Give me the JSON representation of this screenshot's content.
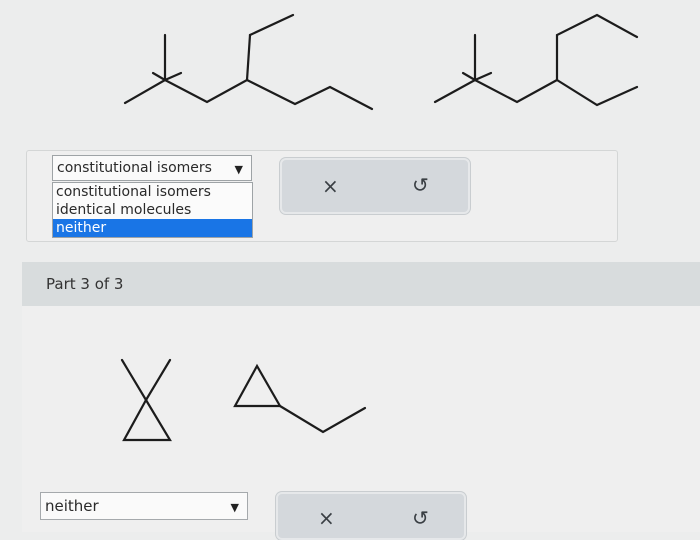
{
  "part2": {
    "answer_select": {
      "selected_value": "constitutional isomers",
      "options": [
        "constitutional isomers",
        "identical molecules",
        "neither"
      ],
      "highlighted_option": "neither"
    }
  },
  "part3": {
    "title": "Part 3 of 3",
    "answer_select": {
      "selected_value": "neither"
    }
  },
  "icons": {
    "clear": "×",
    "undo": "↺",
    "caret": "▼"
  },
  "colors": {
    "highlight": "#1975e6",
    "header_bg": "#d8dcdd",
    "button_group_bg": "#d4d8dc"
  }
}
